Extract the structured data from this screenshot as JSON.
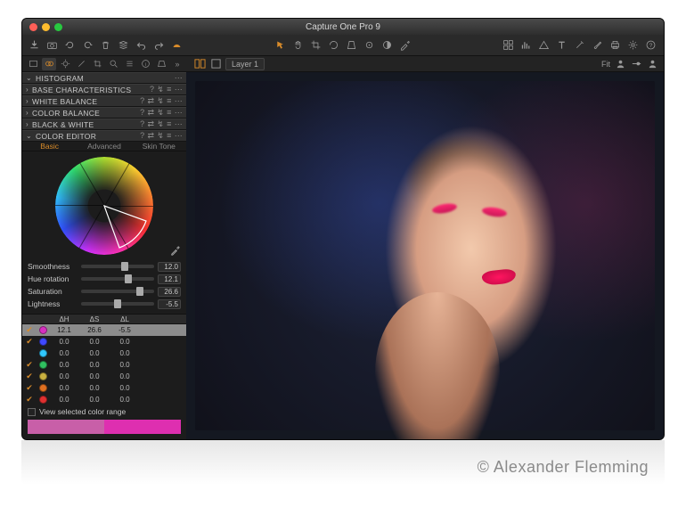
{
  "window": {
    "title": "Capture One Pro 9"
  },
  "layers": {
    "current": "Layer 1",
    "fit_label": "Fit"
  },
  "panels": [
    {
      "name": "HISTOGRAM",
      "open": true
    },
    {
      "name": "BASE CHARACTERISTICS",
      "open": false
    },
    {
      "name": "WHITE BALANCE",
      "open": false
    },
    {
      "name": "COLOR BALANCE",
      "open": false
    },
    {
      "name": "BLACK & WHITE",
      "open": false
    },
    {
      "name": "COLOR EDITOR",
      "open": true
    }
  ],
  "color_editor": {
    "tabs": [
      "Basic",
      "Advanced",
      "Skin Tone"
    ],
    "active_tab": "Basic",
    "sliders": {
      "smoothness": {
        "label": "Smoothness",
        "value": "12.0",
        "pos": 0.55
      },
      "hue": {
        "label": "Hue rotation",
        "value": "12.1",
        "pos": 0.6
      },
      "saturation": {
        "label": "Saturation",
        "value": "26.6",
        "pos": 0.75
      },
      "lightness": {
        "label": "Lightness",
        "value": "-5.5",
        "pos": 0.45
      }
    },
    "columns": {
      "dh": "ΔH",
      "ds": "ΔS",
      "dl": "ΔL"
    },
    "rows": [
      {
        "checked": true,
        "swatch": "#d730c0",
        "dh": "12.1",
        "ds": "26.6",
        "dl": "-5.5",
        "selected": true
      },
      {
        "checked": true,
        "swatch": "#4048ff",
        "dh": "0.0",
        "ds": "0.0",
        "dl": "0.0"
      },
      {
        "checked": false,
        "swatch": "#30c8ff",
        "dh": "0.0",
        "ds": "0.0",
        "dl": "0.0"
      },
      {
        "checked": true,
        "swatch": "#30c060",
        "dh": "0.0",
        "ds": "0.0",
        "dl": "0.0"
      },
      {
        "checked": true,
        "swatch": "#c8b040",
        "dh": "0.0",
        "ds": "0.0",
        "dl": "0.0"
      },
      {
        "checked": true,
        "swatch": "#e07020",
        "dh": "0.0",
        "ds": "0.0",
        "dl": "0.0"
      },
      {
        "checked": true,
        "swatch": "#e03030",
        "dh": "0.0",
        "ds": "0.0",
        "dl": "0.0"
      }
    ],
    "view_range_label": "View selected color range",
    "range_swatches": [
      "#c85fa8",
      "#de2fb0"
    ]
  },
  "credit": "© Alexander Flemming"
}
